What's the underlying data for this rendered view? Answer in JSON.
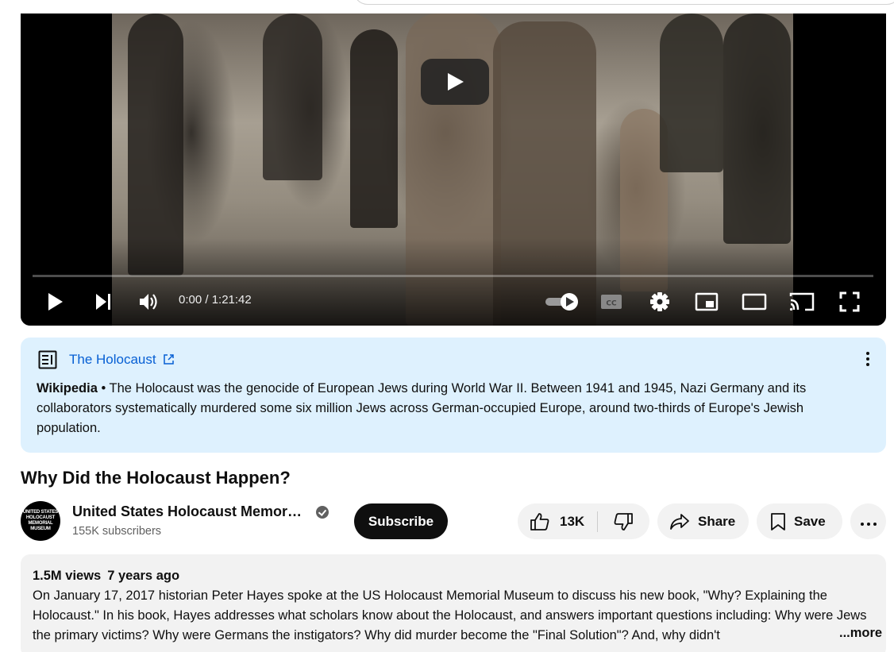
{
  "player": {
    "time_display": "0:00 / 1:21:42",
    "progress": 0,
    "icons": {
      "big_play": "play-icon",
      "play": "play-icon",
      "next": "next-icon",
      "volume": "volume-icon",
      "autoplay": "autoplay-toggle-icon",
      "captions": "captions-icon",
      "settings": "gear-icon",
      "miniplayer": "miniplayer-icon",
      "theater": "theater-icon",
      "cast": "cast-icon",
      "fullscreen": "fullscreen-icon"
    }
  },
  "info_panel": {
    "title": "The Holocaust",
    "source": "Wikipedia",
    "separator": " • ",
    "text": "The Holocaust was the genocide of European Jews during World War II. Between 1941 and 1945, Nazi Germany and its collaborators systematically murdered some six million Jews across German-occupied Europe, around two-thirds of Europe's Jewish population.",
    "background": "#def1fe",
    "link_color": "#065fd4"
  },
  "video": {
    "title": "Why Did the Holocaust Happen?"
  },
  "channel": {
    "name": "United States Holocaust Memor…",
    "subscribers": "155K subscribers",
    "avatar_text": "UNITED STATES HOLOCAUST MEMORIAL MUSEUM",
    "verified": true
  },
  "actions": {
    "subscribe": "Subscribe",
    "likes": "13K",
    "share": "Share",
    "save": "Save"
  },
  "description": {
    "views": "1.5M views",
    "date": "7 years ago",
    "text": "On January 17, 2017 historian Peter Hayes spoke at the US Holocaust Memorial Museum to discuss his new book, \"Why? Explaining the Holocaust.\" In his book, Hayes addresses what scholars know about the Holocaust, and answers important questions including: Why were Jews the primary victims? Why were Germans the instigators? Why did murder become the \"Final Solution\"? And, why didn't",
    "more": "...more"
  }
}
